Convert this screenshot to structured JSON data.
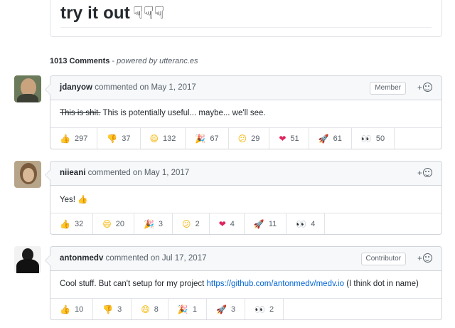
{
  "top": {
    "title": "try it out",
    "hands": "☟☟☟"
  },
  "summary": {
    "count": "1013 Comments",
    "separator": " - ",
    "powered": "powered by utteranc.es"
  },
  "add_reaction_label": "+",
  "comments": [
    {
      "author": "jdanyow",
      "action": "commented on",
      "date": "May 1, 2017",
      "badge": "Member",
      "body_struck": "This is shit.",
      "body_text": " This is potentially useful... maybe... we'll see.",
      "reactions": [
        {
          "icon": "thumbs-up-icon",
          "glyph": "👍",
          "count": "297"
        },
        {
          "icon": "thumbs-down-icon",
          "glyph": "👎",
          "count": "37"
        },
        {
          "icon": "laugh-icon",
          "glyph": "😄",
          "count": "132"
        },
        {
          "icon": "hooray-icon",
          "glyph": "🎉",
          "count": "67"
        },
        {
          "icon": "confused-icon",
          "glyph": "😕",
          "count": "29"
        },
        {
          "icon": "heart-icon",
          "glyph": "❤",
          "count": "51"
        },
        {
          "icon": "rocket-icon",
          "glyph": "🚀",
          "count": "61"
        },
        {
          "icon": "eyes-icon",
          "glyph": "👀",
          "count": "50"
        }
      ]
    },
    {
      "author": "niieani",
      "action": "commented on",
      "date": "May 1, 2017",
      "badge": "",
      "body_text": "Yes! ",
      "body_emoji": "👍",
      "reactions": [
        {
          "icon": "thumbs-up-icon",
          "glyph": "👍",
          "count": "32"
        },
        {
          "icon": "laugh-icon",
          "glyph": "😄",
          "count": "20"
        },
        {
          "icon": "hooray-icon",
          "glyph": "🎉",
          "count": "3"
        },
        {
          "icon": "confused-icon",
          "glyph": "😕",
          "count": "2"
        },
        {
          "icon": "heart-icon",
          "glyph": "❤",
          "count": "4"
        },
        {
          "icon": "rocket-icon",
          "glyph": "🚀",
          "count": "11"
        },
        {
          "icon": "eyes-icon",
          "glyph": "👀",
          "count": "4"
        }
      ]
    },
    {
      "author": "antonmedv",
      "action": "commented on",
      "date": "Jul 17, 2017",
      "badge": "Contributor",
      "body_text": "Cool stuff. But can't setup for my project ",
      "body_link": "https://github.com/antonmedv/medv.io",
      "body_after": " (I think dot in name)",
      "reactions": [
        {
          "icon": "thumbs-up-icon",
          "glyph": "👍",
          "count": "10"
        },
        {
          "icon": "thumbs-down-icon",
          "glyph": "👎",
          "count": "3"
        },
        {
          "icon": "laugh-icon",
          "glyph": "😄",
          "count": "8"
        },
        {
          "icon": "hooray-icon",
          "glyph": "🎉",
          "count": "1"
        },
        {
          "icon": "rocket-icon",
          "glyph": "🚀",
          "count": "3"
        },
        {
          "icon": "eyes-icon",
          "glyph": "👀",
          "count": "2"
        }
      ]
    }
  ]
}
